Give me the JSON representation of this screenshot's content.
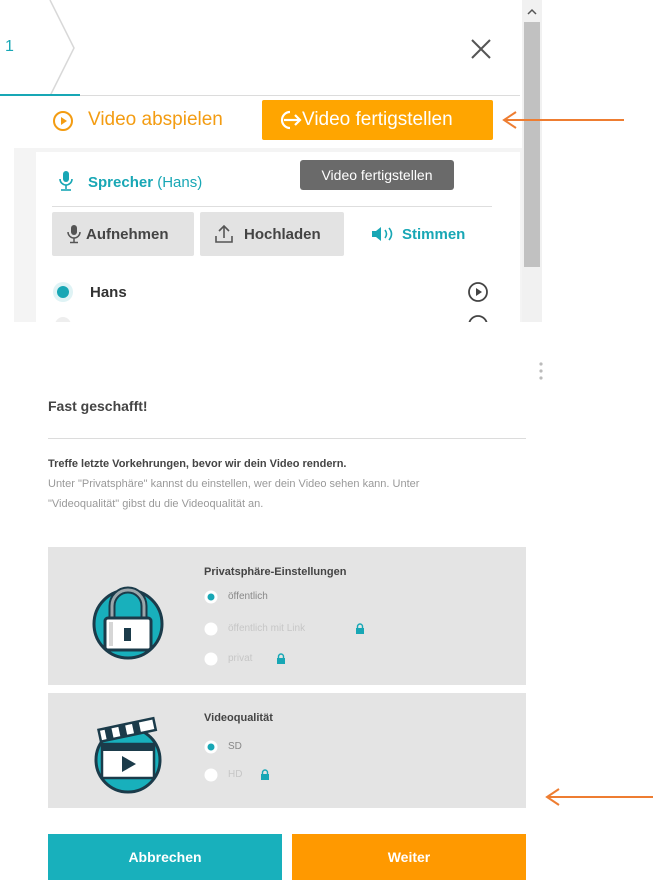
{
  "editor": {
    "tab_number": "1",
    "close_icon": "close-icon",
    "play_button": "Video abspielen",
    "finish_button": "Video fertigstellen",
    "tooltip": "Video fertigstellen",
    "speaker": {
      "label": "Sprecher",
      "name": "(Hans)"
    },
    "record_button": "Aufnehmen",
    "upload_button": "Hochladen",
    "voices_link": "Stimmen",
    "voice_option": "Hans",
    "colors": {
      "accent_orange": "#ffa500",
      "teal": "#18a7b5"
    }
  },
  "dialog": {
    "title": "Fast geschafft!",
    "intro_bold": "Treffe letzte Vorkehrungen, bevor wir dein Video rendern.",
    "intro_line1": "Unter \"Privatsphäre\" kannst du einstellen, wer dein Video sehen kann. Unter",
    "intro_line2": "\"Videoqualität\" gibst du die Videoqualität an.",
    "privacy": {
      "title": "Privatsphäre-Einstellungen",
      "options": [
        "öffentlich",
        "öffentlich mit Link",
        "privat"
      ],
      "selected": "öffentlich"
    },
    "quality": {
      "title": "Videoqualität",
      "options": [
        "SD",
        "HD"
      ],
      "selected": "SD"
    },
    "cancel_button": "Abbrechen",
    "next_button": "Weiter",
    "colors": {
      "cancel": "#18b0bc",
      "next": "#ff9900",
      "annotation_arrow": "#ee7d31"
    }
  }
}
